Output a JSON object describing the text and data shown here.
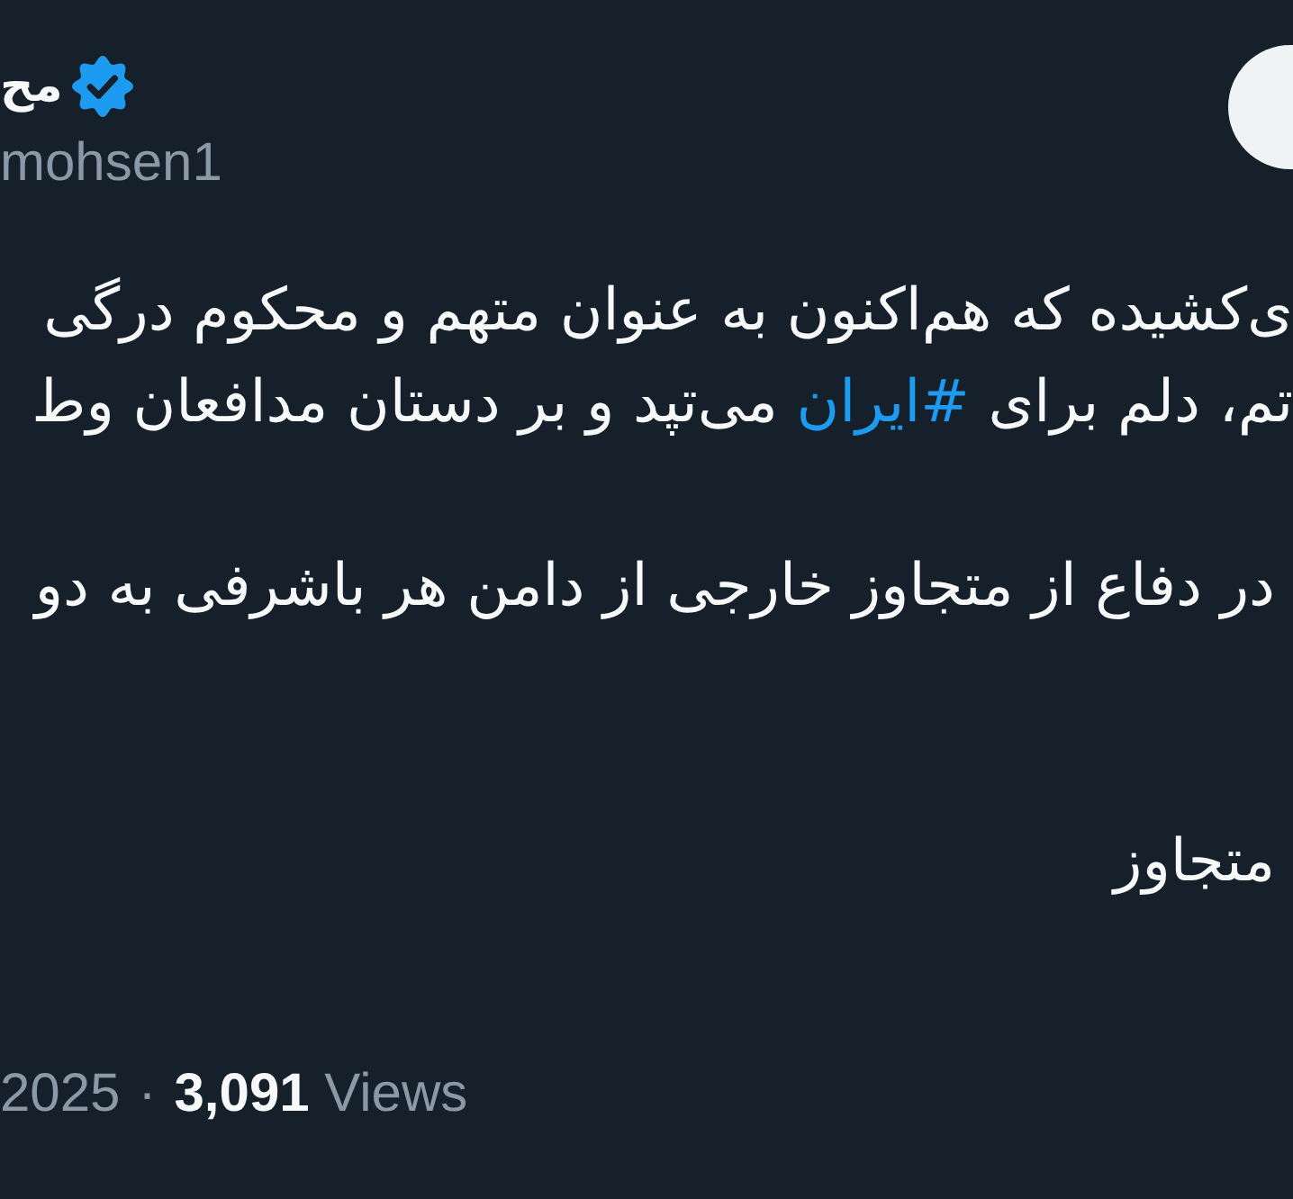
{
  "author": {
    "name": "مح",
    "verified": true,
    "handle": "mohsen1"
  },
  "body": [
    {
      "lines": [
        [
          {
            "kind": "text",
            "text": "ی‌کشیده که هم‌اکنون به عنوان متهم و محکوم درگی"
          }
        ],
        [
          {
            "kind": "text",
            "text": "تم، دلم برای "
          },
          {
            "kind": "hashtag",
            "text": "#ایران"
          },
          {
            "kind": "text",
            "text": " می‌تپد و بر دستان مدافعان وط"
          }
        ]
      ]
    },
    {
      "lines": [
        [
          {
            "kind": "text",
            "text": "در دفاع از متجاوز خارجی از دامن هر باشرفی به دو"
          }
        ]
      ]
    },
    {
      "lines": [
        [
          {
            "kind": "text",
            "text": "متجاوز"
          }
        ]
      ]
    }
  ],
  "meta": {
    "date": "2025",
    "separator": "·",
    "views": "**3,091** Views"
  }
}
